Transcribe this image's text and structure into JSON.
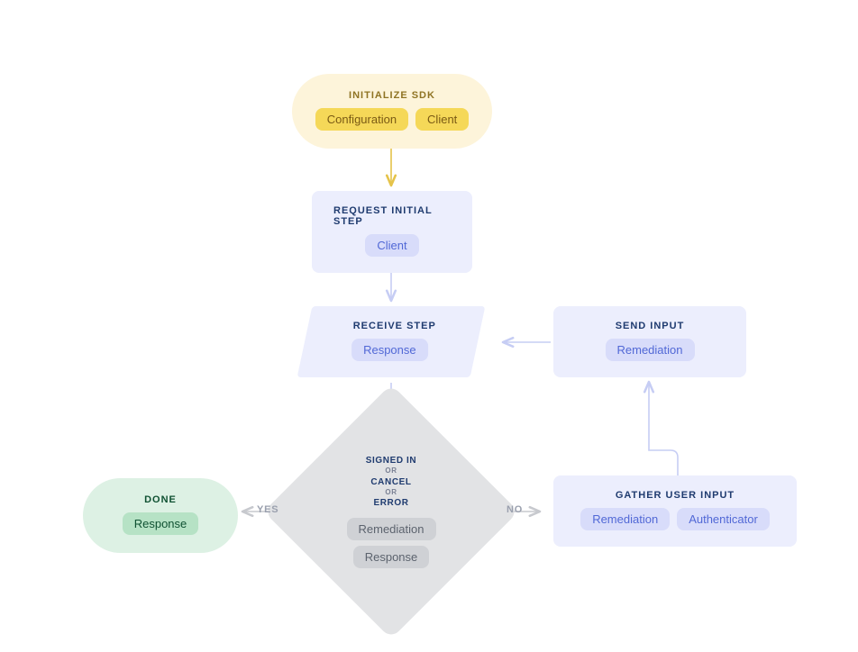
{
  "initialize": {
    "title": "INITIALIZE SDK",
    "chip1": "Configuration",
    "chip2": "Client"
  },
  "request_initial": {
    "title": "REQUEST INITIAL STEP",
    "chip1": "Client"
  },
  "receive_step": {
    "title": "RECEIVE STEP",
    "chip1": "Response"
  },
  "send_input": {
    "title": "SEND INPUT",
    "chip1": "Remediation"
  },
  "decision": {
    "signed_in": "SIGNED IN",
    "or1": "OR",
    "cancel": "CANCEL",
    "or2": "OR",
    "error": "ERROR",
    "chip1": "Remediation",
    "chip2": "Response"
  },
  "done": {
    "title": "DONE",
    "chip1": "Response"
  },
  "gather_input": {
    "title": "GATHER USER INPUT",
    "chip1": "Remediation",
    "chip2": "Authenticator"
  },
  "edge_labels": {
    "yes": "YES",
    "no": "NO"
  },
  "colors": {
    "arrow_yellow": "#e5c34a",
    "arrow_blue": "#c6cdf4",
    "arrow_gray": "#c7c9ce"
  }
}
